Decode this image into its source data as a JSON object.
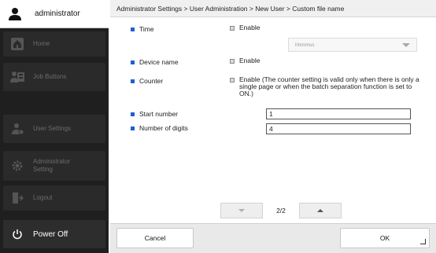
{
  "sidebar": {
    "user": "administrator",
    "items": [
      {
        "label": "Home",
        "icon": "home-icon"
      },
      {
        "label": "Job Buttons",
        "icon": "job-buttons-icon"
      },
      {
        "label": "User Settings",
        "icon": "user-settings-icon"
      },
      {
        "label": "Administrator Setting",
        "icon": "gear-icon"
      },
      {
        "label": "Logout",
        "icon": "logout-icon"
      }
    ],
    "power_label": "Power Off"
  },
  "breadcrumb": "Administrator Settings > User Administration > New User > Custom file name",
  "form": {
    "time_label": "Time",
    "time_enable": "Enable",
    "time_format": "hhmmss",
    "device_label": "Device name",
    "device_enable": "Enable",
    "counter_label": "Counter",
    "counter_enable": "Enable (The counter setting is valid only when there is only a single page or when the batch separation function is set to ON.)",
    "start_label": "Start number",
    "start_value": "1",
    "digits_label": "Number of digits",
    "digits_value": "4"
  },
  "pager": {
    "page": "2/2"
  },
  "buttons": {
    "cancel": "Cancel",
    "ok": "OK"
  },
  "colors": {
    "accent": "#1f5fd0",
    "sidebar": "#1f1f1f"
  }
}
